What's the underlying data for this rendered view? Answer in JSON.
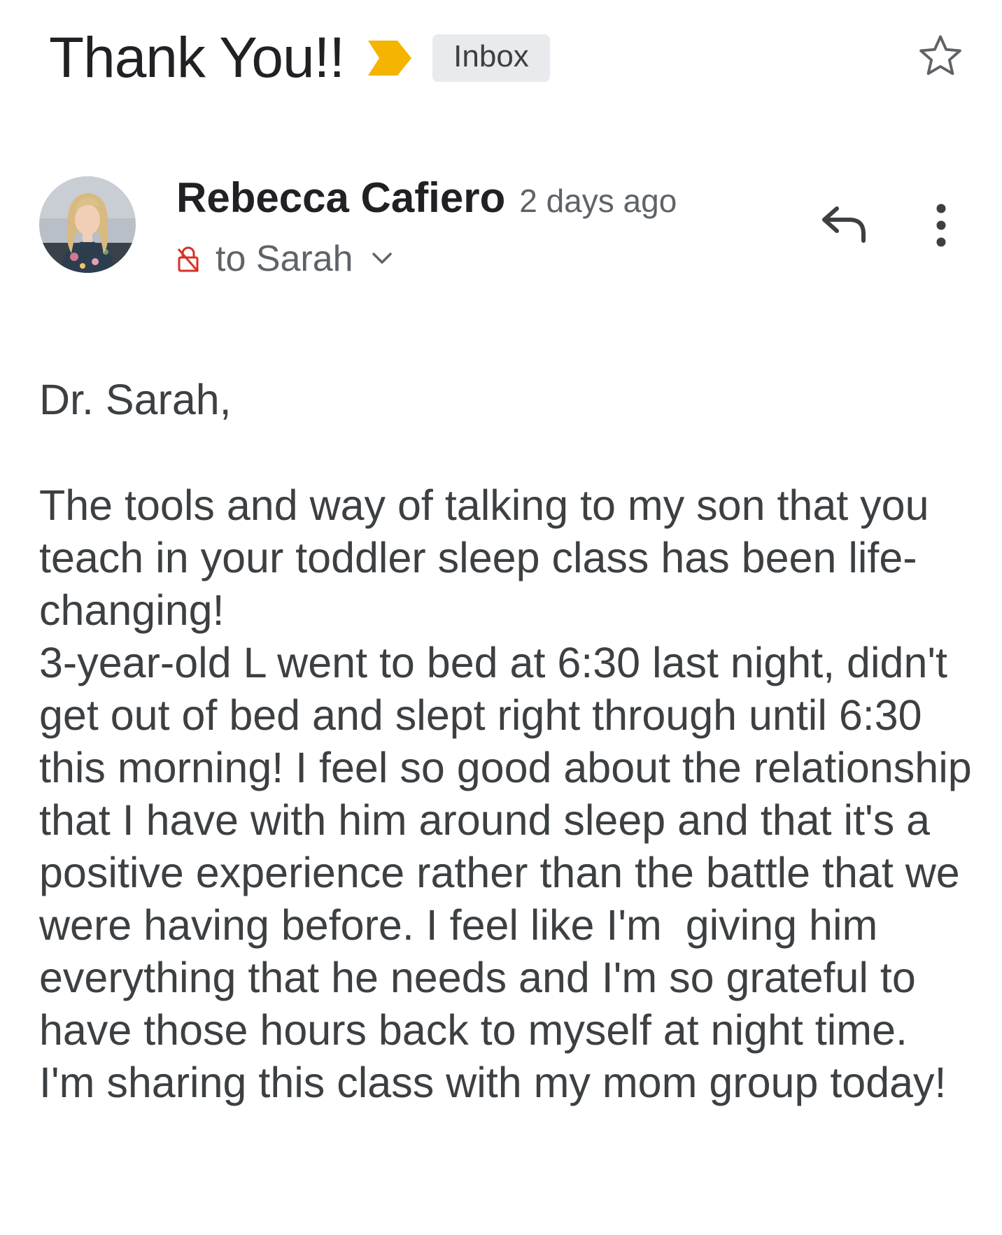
{
  "email": {
    "subject": "Thank You!!",
    "label": "Inbox",
    "importance_color": "#f4b400",
    "sender_name": "Rebecca Cafiero",
    "time": "2 days ago",
    "recipient": "to Sarah",
    "lock_color": "#d93025"
  },
  "icons": {
    "importance": "importance-marker-icon",
    "star": "star-outline-icon",
    "lock": "unencrypted-lock-icon",
    "chevron": "chevron-down-icon",
    "reply": "reply-icon",
    "more": "more-vert-icon"
  },
  "body": {
    "greeting": "Dr. Sarah,",
    "paragraph1": "The tools and way of talking to my son that you teach in your toddler sleep class has been life-changing!",
    "paragraph2": "3-year-old L went to bed at 6:30 last night, didn't get out of bed and slept right through until 6:30 this morning! I feel so good about the relationship that I have with him around sleep and that it's a positive experience rather than the battle that we were having before. I feel like I'm  giving him everything that he needs and I'm so grateful to have those hours back to myself at night time.  I'm sharing this class with my mom group today!"
  }
}
